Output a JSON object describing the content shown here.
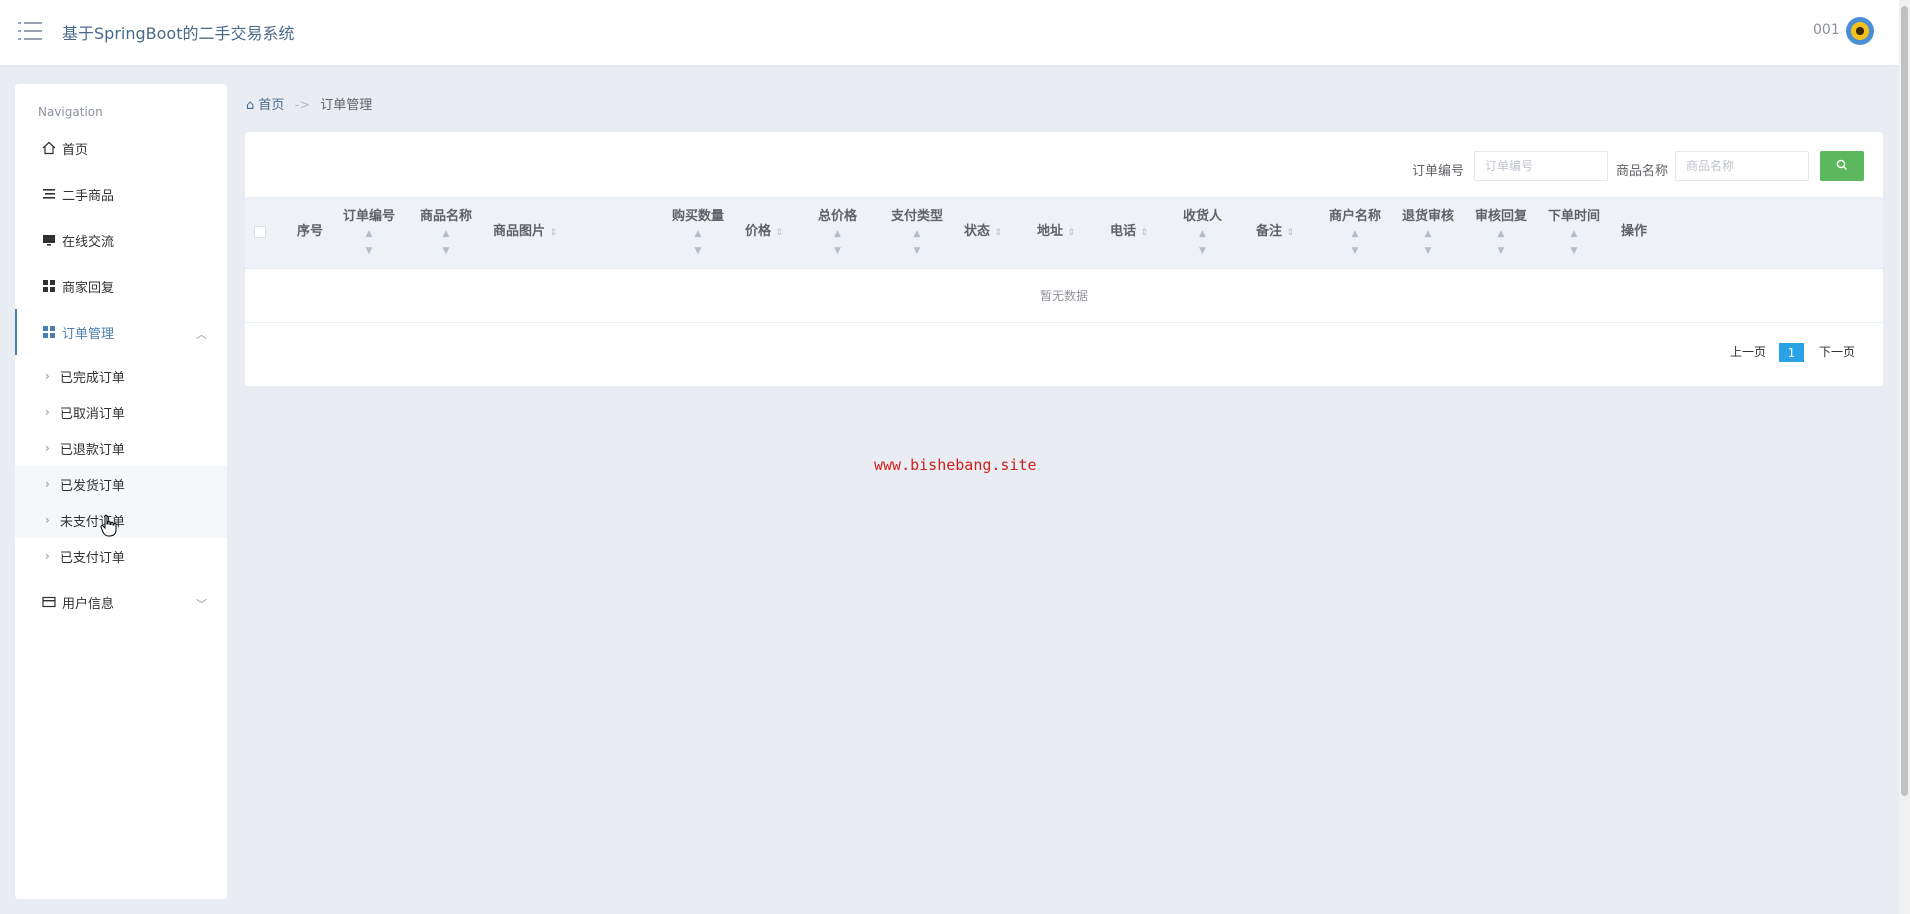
{
  "header": {
    "title": "基于SpringBoot的二手交易系统",
    "user": "001",
    "menu_icon": "hamburger-icon",
    "avatar_icon": "sunflower-avatar"
  },
  "sidebar": {
    "caption": "Navigation",
    "items": [
      {
        "label": "首页",
        "icon": "home-icon"
      },
      {
        "label": "二手商品",
        "icon": "list-icon"
      },
      {
        "label": "在线交流",
        "icon": "monitor-icon"
      },
      {
        "label": "商家回复",
        "icon": "grid-icon"
      },
      {
        "label": "订单管理",
        "icon": "grid-icon",
        "expanded": true
      },
      {
        "label": "用户信息",
        "icon": "card-icon",
        "expanded": false
      }
    ],
    "subitems": [
      "已完成订单",
      "已取消订单",
      "已退款订单",
      "已发货订单",
      "未支付订单",
      "已支付订单"
    ]
  },
  "breadcrumb": {
    "home": "首页",
    "sep": "->",
    "current": "订单管理"
  },
  "search": {
    "order_label": "订单编号",
    "order_placeholder": "订单编号",
    "product_label": "商品名称",
    "product_placeholder": "商品名称"
  },
  "table": {
    "columns": [
      "序号",
      "订单编号",
      "商品名称",
      "商品图片",
      "购买数量",
      "价格",
      "总价格",
      "支付类型",
      "状态",
      "地址",
      "电话",
      "收货人",
      "备注",
      "商户名称",
      "退货审核",
      "审核回复",
      "下单时间",
      "操作"
    ],
    "empty_text": "暂无数据"
  },
  "pagination": {
    "prev": "上一页",
    "current": "1",
    "next": "下一页"
  },
  "watermark": "www.bishebang.site",
  "colors": {
    "accent": "#4a7fb0",
    "search_button": "#5cb85c",
    "page_active": "#2aa2e6",
    "watermark": "#d0201a"
  }
}
